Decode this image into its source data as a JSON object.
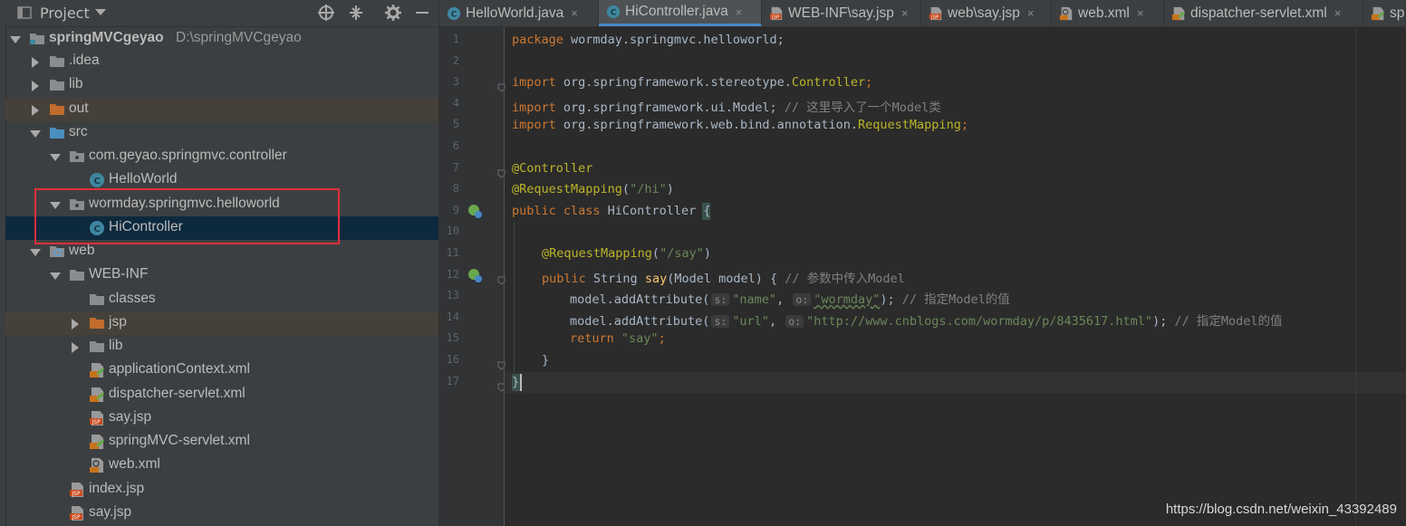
{
  "project_panel": {
    "title": "Project",
    "icons": [
      "chevron-down-icon",
      "locate-icon",
      "collapse-icon",
      "gear-icon",
      "minimize-icon"
    ]
  },
  "tree": [
    {
      "label": "springMVCgeyao",
      "path": "D:\\springMVCgeyao",
      "icon": "module-folder-icon",
      "expanded": true
    },
    {
      "label": ".idea",
      "icon": "folder-icon",
      "expanded": false
    },
    {
      "label": "lib",
      "icon": "folder-icon",
      "expanded": false
    },
    {
      "label": "out",
      "icon": "orange-folder-icon",
      "expanded": false
    },
    {
      "label": "src",
      "icon": "source-folder-icon",
      "expanded": true
    },
    {
      "label": "com.geyao.springmvc.controller",
      "icon": "package-icon",
      "expanded": true
    },
    {
      "label": "HelloWorld",
      "icon": "java-class-icon"
    },
    {
      "label": "wormday.springmvc.helloworld",
      "icon": "package-icon",
      "expanded": true
    },
    {
      "label": "HiController",
      "icon": "java-class-icon"
    },
    {
      "label": "web",
      "icon": "web-folder-icon",
      "expanded": true
    },
    {
      "label": "WEB-INF",
      "icon": "folder-icon",
      "expanded": true
    },
    {
      "label": "classes",
      "icon": "folder-icon"
    },
    {
      "label": "jsp",
      "icon": "orange-folder-icon",
      "expanded": false
    },
    {
      "label": "lib",
      "icon": "folder-icon",
      "expanded": false
    },
    {
      "label": "applicationContext.xml",
      "icon": "spring-xml-icon"
    },
    {
      "label": "dispatcher-servlet.xml",
      "icon": "spring-xml-icon"
    },
    {
      "label": "say.jsp",
      "icon": "jsp-file-icon"
    },
    {
      "label": "springMVC-servlet.xml",
      "icon": "spring-xml-icon"
    },
    {
      "label": "web.xml",
      "icon": "web-xml-icon"
    },
    {
      "label": "index.jsp",
      "icon": "jsp-file-icon"
    },
    {
      "label": "say.jsp",
      "icon": "jsp-file-icon"
    }
  ],
  "tabs": [
    {
      "label": "HelloWorld.java",
      "icon": "java-class-icon"
    },
    {
      "label": "HiController.java",
      "icon": "java-class-icon",
      "active": true
    },
    {
      "label": "WEB-INF\\say.jsp",
      "icon": "jsp-file-icon"
    },
    {
      "label": "web\\say.jsp",
      "icon": "jsp-file-icon"
    },
    {
      "label": "web.xml",
      "icon": "web-xml-icon"
    },
    {
      "label": "dispatcher-servlet.xml",
      "icon": "spring-xml-icon"
    },
    {
      "label": "sp",
      "icon": "spring-xml-icon"
    }
  ],
  "editor": {
    "line_numbers": [
      "1",
      "2",
      "3",
      "4",
      "5",
      "6",
      "7",
      "8",
      "9",
      "10",
      "11",
      "12",
      "13",
      "14",
      "15",
      "16",
      "17"
    ],
    "lines": [
      {
        "k1": "package",
        "t1": " wormday.springmvc.helloworld;"
      },
      {},
      {
        "k1": "import",
        "t1": " org.springframework.stereotype.",
        "a1": "Controller",
        "k2": ";"
      },
      {
        "k1": "import",
        "t1": " org.springframework.ui.Model; ",
        "c1": "// 这里导入了一个Model类"
      },
      {
        "k1": "import",
        "t1": " org.springframework.web.bind.annotation.",
        "a1": "RequestMapping",
        "k2": ";"
      },
      {},
      {
        "a1": "@Controller"
      },
      {
        "a1": "@RequestMapping",
        "t1": "(",
        "s1": "\"/hi\"",
        "t2": ")"
      },
      {
        "k1": "public class",
        "t1": " HiController ",
        "t2": "{"
      },
      {},
      {
        "a1": "@RequestMapping",
        "t1": "(",
        "s1": "\"/say\"",
        "t2": ")"
      },
      {
        "k1": "public",
        "t1": " String ",
        "f1": "say",
        "t2": "(Model model) { ",
        "c1": "// 参数中传入Model"
      },
      {
        "t1": "model.addAttribute(",
        "h1": "s:",
        "s1": "\"name\"",
        "t2": ", ",
        "h2": "o:",
        "s2": "\"wormday\"",
        "t3": "); ",
        "c1": "// 指定Model的值"
      },
      {
        "t1": "model.addAttribute(",
        "h1": "s:",
        "s1": "\"url\"",
        "t2": ", ",
        "h2": "o:",
        "s2": "\"http://www.cnblogs.com/wormday/p/8435617.html\"",
        "t3": "); ",
        "c1": "// 指定Model的值"
      },
      {
        "k1": "return",
        "s1": " \"say\"",
        "k2": ";"
      },
      {
        "t1": "}"
      },
      {
        "t1": "}"
      }
    ]
  },
  "watermark": "https://blog.csdn.net/weixin_43392489",
  "colors": {
    "keyword": "#cc7832",
    "annotation": "#bbb529",
    "string": "#6a8759",
    "comment": "#808080",
    "selection": "#0d293e",
    "highlight_box": "#e0303a"
  }
}
